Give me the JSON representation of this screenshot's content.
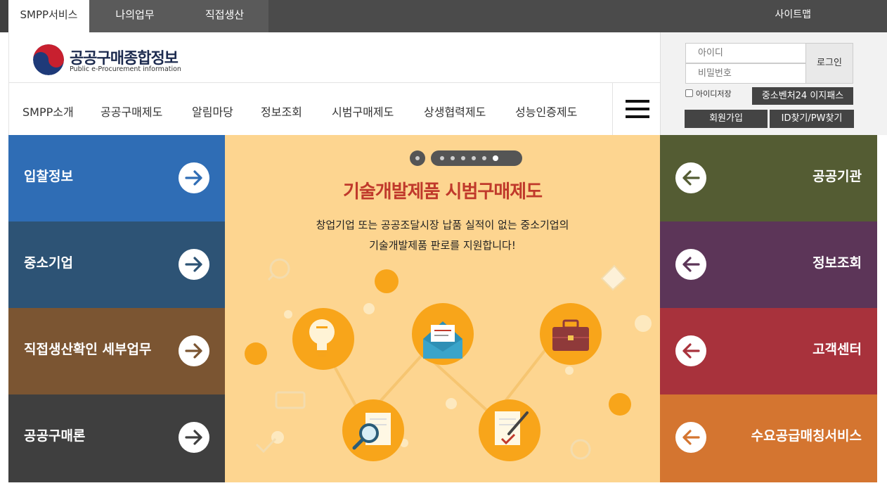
{
  "top_tabs": [
    "SMPP서비스",
    "나의업무",
    "직접생산"
  ],
  "sitemap_label": "사이트맵",
  "logo": {
    "title": "공공구매종합정보",
    "subtitle": "Public e-Procurement information"
  },
  "gnb": [
    "SMPP소개",
    "공공구매제도",
    "알림마당",
    "정보조회",
    "시범구매제도",
    "상생협력제도",
    "성능인증제도"
  ],
  "login": {
    "id_placeholder": "아이디",
    "pw_placeholder": "비밀번호",
    "login_label": "로그인",
    "remember_label": "아이디저장",
    "ezpass_label": "중소벤처24 이지패스",
    "join_label": "회원가입",
    "find_label": "ID찾기/PW찾기"
  },
  "left_tiles": [
    {
      "label": "입찰정보",
      "color": "#2f6db5"
    },
    {
      "label": "중소기업",
      "color": "#2d5375"
    },
    {
      "label": "직접생산확인 세부업무",
      "color": "#7b5532"
    },
    {
      "label": "공공구매론",
      "color": "#3f3f3f"
    }
  ],
  "right_tiles": [
    {
      "label": "공공기관",
      "color": "#545c33"
    },
    {
      "label": "정보조회",
      "color": "#5c3558"
    },
    {
      "label": "고객센터",
      "color": "#a8323c"
    },
    {
      "label": "수요공급매칭서비스",
      "color": "#d47530"
    }
  ],
  "banner": {
    "title": "기술개발제품 시범구매제도",
    "desc_line1": "창업기업 또는 공공조달시장 납품 실적이 없는 중소기업의",
    "desc_line2": "기술개발제품 판로를 지원합니다!",
    "slide_count": 6,
    "active_slide": 6,
    "background": "#fdd590"
  },
  "icons": {
    "menu": "hamburger-icon",
    "tile_arrow_left": "arrow-right-icon",
    "tile_arrow_right": "arrow-left-icon",
    "logo": "taegeuk-icon"
  }
}
